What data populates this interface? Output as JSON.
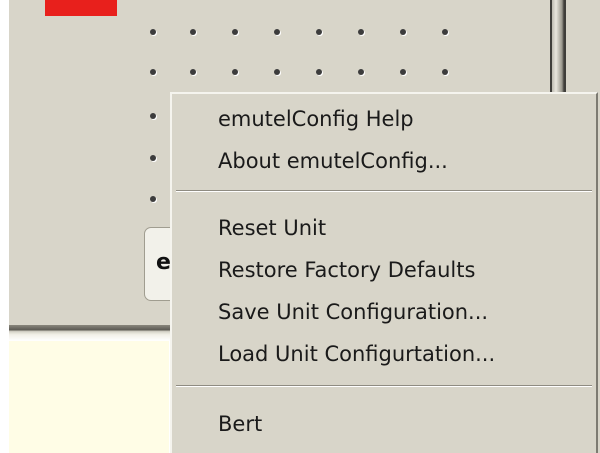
{
  "colors": {
    "panel_background": "#d8d5c9",
    "menu_background": "#d8d5c9",
    "lower_area": "#fffde6",
    "red_indicator": "#e8201c",
    "text": "#1a1a1a"
  },
  "background_button": {
    "label": "e"
  },
  "context_menu": {
    "items": [
      {
        "label": "emutelConfig Help"
      },
      {
        "label": "About emutelConfig..."
      },
      {
        "label": "Reset Unit"
      },
      {
        "label": "Restore Factory Defaults"
      },
      {
        "label": "Save Unit Configuration..."
      },
      {
        "label": "Load Unit Configurtation..."
      },
      {
        "label": "Bert"
      }
    ]
  }
}
